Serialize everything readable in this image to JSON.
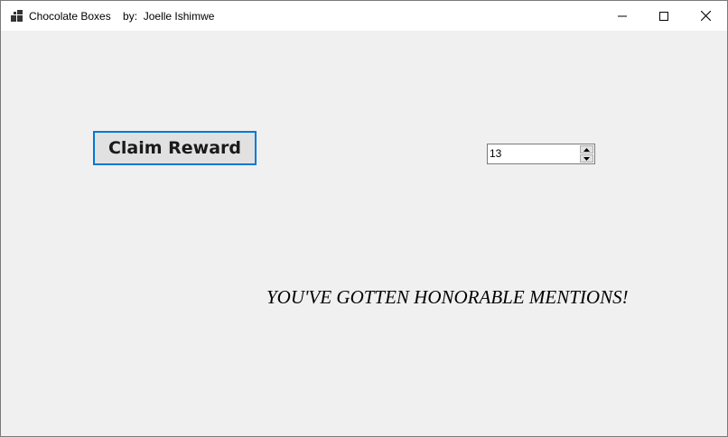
{
  "window": {
    "title": "Chocolate Boxes    by:  Joelle Ishimwe",
    "app_icon": "app-icon",
    "controls": {
      "minimize_icon": "minimize-icon",
      "maximize_icon": "maximize-icon",
      "close_icon": "close-icon"
    }
  },
  "form": {
    "claim_button_label": "Claim Reward",
    "spinner_value": "13",
    "spinner_up_icon": "chevron-up-icon",
    "spinner_down_icon": "chevron-down-icon",
    "message": "YOU'VE GOTTEN HONORABLE MENTIONS!"
  },
  "colors": {
    "focus_border": "#0078d7",
    "client_background": "#f0f0f0",
    "button_face": "#e1e1e1",
    "titlebar": "#ffffff"
  }
}
